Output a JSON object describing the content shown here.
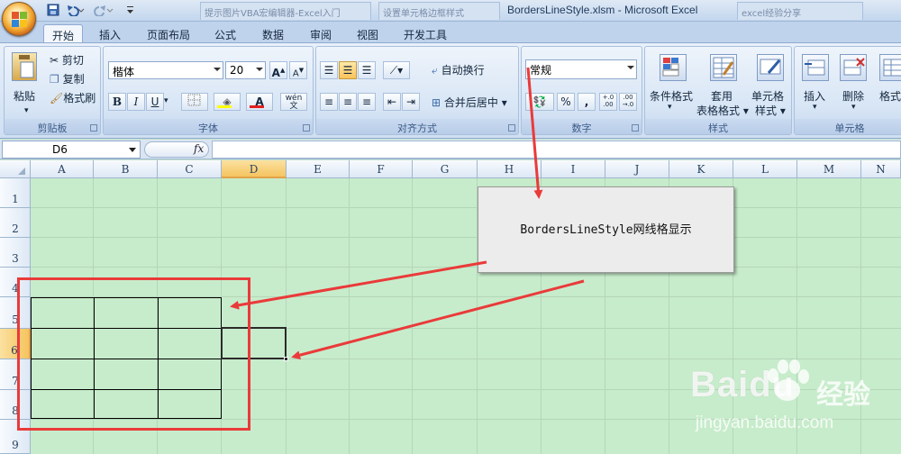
{
  "window": {
    "title": "BordersLineStyle.xlsm - Microsoft Excel",
    "ghost_tabs": [
      "提示图片VBA宏编辑器-Excel入门",
      "设置单元格边框样式",
      "excel经验分享"
    ]
  },
  "ribbon_tabs": [
    "开始",
    "插入",
    "页面布局",
    "公式",
    "数据",
    "审阅",
    "视图",
    "开发工具"
  ],
  "active_tab": "开始",
  "clipboard": {
    "paste": "粘贴",
    "cut": "剪切",
    "copy": "复制",
    "format_painter": "格式刷",
    "label": "剪贴板"
  },
  "font": {
    "name": "楷体",
    "size": "20",
    "grow": "A",
    "shrink": "A",
    "bold": "B",
    "italic": "I",
    "underline": "U",
    "font_color_letter": "A",
    "phonetic": "wén 文",
    "label": "字体"
  },
  "alignment": {
    "wrap_text": "自动换行",
    "merge_center": "合并后居中",
    "label": "对齐方式"
  },
  "number": {
    "format": "常规",
    "percent": "%",
    "comma": ",",
    "inc_decimal": "+.0 .00",
    "dec_decimal": ".00 →.0",
    "label": "数字"
  },
  "styles": {
    "conditional": "条件格式",
    "table_line1": "套用",
    "table_line2": "表格格式",
    "cell_line1": "单元格",
    "cell_line2": "样式",
    "label": "样式"
  },
  "cells_group": {
    "insert": "插入",
    "delete": "删除",
    "format": "格式",
    "label": "单元格"
  },
  "name_box": "D6",
  "fx": "fx",
  "columns": [
    "A",
    "B",
    "C",
    "D",
    "E",
    "F",
    "G",
    "H",
    "I",
    "J",
    "K",
    "L",
    "M",
    "N"
  ],
  "selected_column": "D",
  "rows": [
    "1",
    "2",
    "3",
    "4",
    "5",
    "6",
    "7",
    "8",
    "9"
  ],
  "selected_row": "6",
  "annotation_text": "BordersLineStyle网线格显示",
  "watermark": {
    "brand": "Baidu",
    "cn": "经验",
    "url": "jingyan.baidu.com"
  },
  "colors": {
    "sheet_bg": "#c7eccb",
    "grid_line": "#b3d6b8",
    "annotation_red": "#ea3a3a",
    "selection_header": "#f5c45f"
  }
}
